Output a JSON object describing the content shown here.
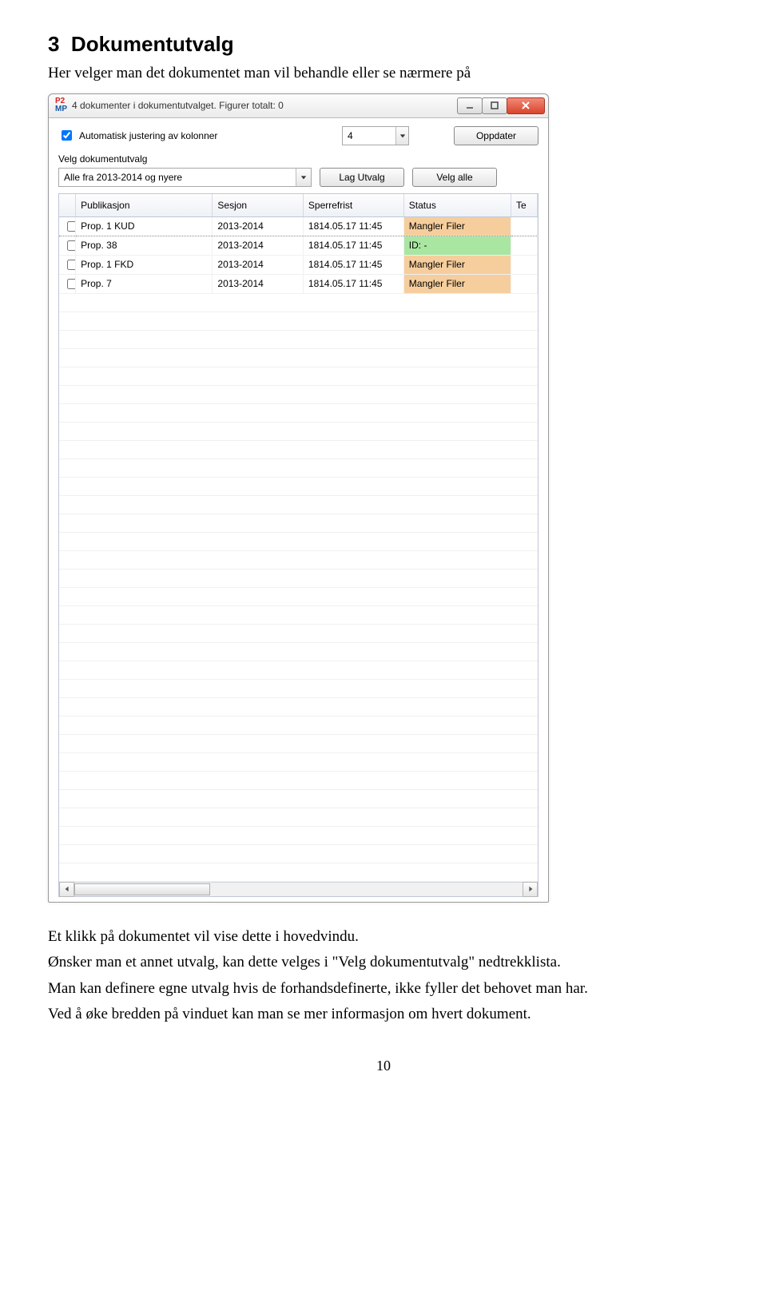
{
  "section": {
    "number": "3",
    "title": "Dokumentutvalg"
  },
  "intro": "Her velger man det dokumentet man vil behandle eller se nærmere på",
  "window": {
    "title": "4 dokumenter i dokumentutvalget. Figurer totalt: 0",
    "auto_adjust_label": "Automatisk justering av kolonner",
    "column_count": "4",
    "update_btn": "Oppdater",
    "select_label": "Velg dokumentutvalg",
    "select_value": "Alle fra 2013-2014 og nyere",
    "make_selection_btn": "Lag Utvalg",
    "select_all_btn": "Velg alle",
    "columns": {
      "publication": "Publikasjon",
      "session": "Sesjon",
      "deadline": "Sperrefrist",
      "status": "Status",
      "te": "Te"
    },
    "rows": [
      {
        "pub": "Prop. 1   KUD",
        "ses": "2013-2014",
        "dead": "1814.05.17 11:45",
        "status": "Mangler Filer",
        "cls": "status-miss"
      },
      {
        "pub": "Prop. 38",
        "ses": "2013-2014",
        "dead": "1814.05.17 11:45",
        "status": "ID: -",
        "cls": "status-ok"
      },
      {
        "pub": "Prop. 1   FKD",
        "ses": "2013-2014",
        "dead": "1814.05.17 11:45",
        "status": "Mangler Filer",
        "cls": "status-miss"
      },
      {
        "pub": "Prop. 7",
        "ses": "2013-2014",
        "dead": "1814.05.17 11:45",
        "status": "Mangler Filer",
        "cls": "status-miss"
      }
    ]
  },
  "bodytext": {
    "p1": "Et klikk på dokumentet vil vise dette i hovedvindu.",
    "p2": "Ønsker man et annet utvalg, kan dette velges i \"Velg dokumentutvalg\" nedtrekklista.",
    "p3": "Man kan definere egne utvalg hvis de forhandsdefinerte, ikke fyller det behovet man har.",
    "p4": "Ved å øke bredden på vinduet kan man se mer informasjon om hvert dokument."
  },
  "page_number": "10"
}
